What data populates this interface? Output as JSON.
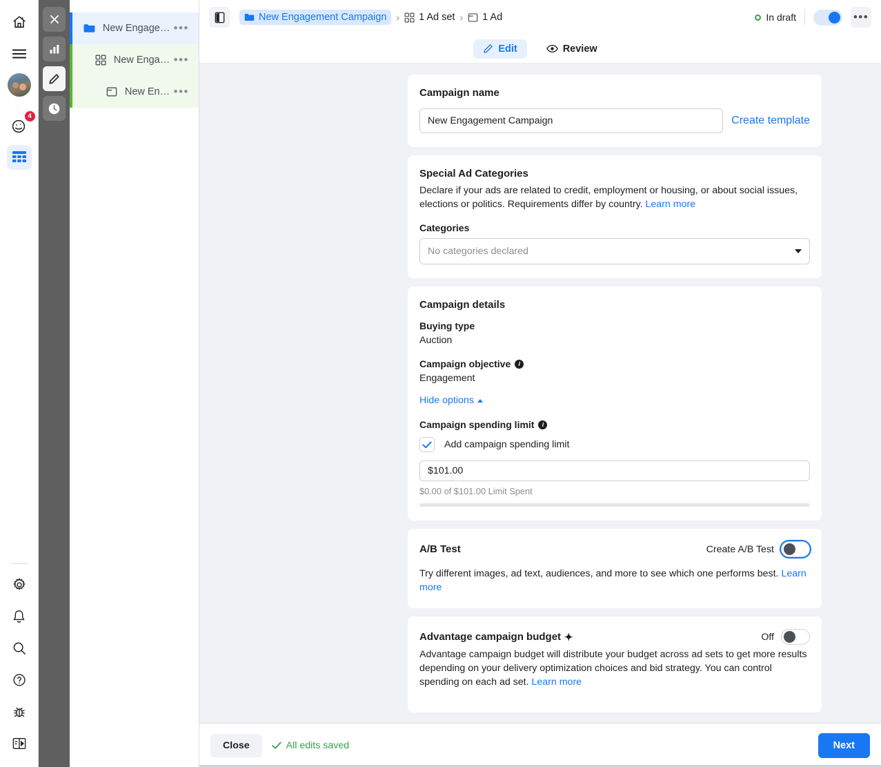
{
  "rail": {
    "items": [
      {
        "name": "home-icon",
        "label": "Home"
      },
      {
        "name": "menu-icon",
        "label": "Menu"
      },
      {
        "name": "avatar",
        "label": "Profile"
      },
      {
        "name": "sparkle-icon",
        "label": "Notifications",
        "badge": "4"
      },
      {
        "name": "grid-icon",
        "label": "Ads Manager",
        "active": true
      }
    ],
    "bottom_items": [
      {
        "name": "gear-icon",
        "label": "Settings"
      },
      {
        "name": "bell-icon",
        "label": "Alerts"
      },
      {
        "name": "search-icon",
        "label": "Search"
      },
      {
        "name": "help-icon",
        "label": "Help"
      },
      {
        "name": "bug-icon",
        "label": "Report bug"
      },
      {
        "name": "panel-icon",
        "label": "Toggle panel"
      }
    ]
  },
  "darkbar": {
    "items": [
      {
        "name": "close-icon",
        "label": "Close"
      },
      {
        "name": "chart-icon",
        "label": "Charts"
      },
      {
        "name": "pencil-icon",
        "label": "Edit",
        "active": true
      },
      {
        "name": "clock-icon",
        "label": "History"
      }
    ]
  },
  "tree": {
    "items": [
      {
        "label": "New Engage…",
        "icon": "folder-icon",
        "type": "campaign",
        "menu": "•••"
      },
      {
        "label": "New Enga…",
        "icon": "adset-grid-icon",
        "type": "adset",
        "menu": "•••"
      },
      {
        "label": "New En…",
        "icon": "ad-window-icon",
        "type": "ad",
        "menu": "•••"
      }
    ]
  },
  "topbar": {
    "breadcrumb": [
      {
        "label": "New Engagement Campaign",
        "icon": "folder-icon",
        "active": true
      },
      {
        "label": "1 Ad set",
        "icon": "adset-grid-icon",
        "active": false
      },
      {
        "label": "1 Ad",
        "icon": "ad-window-icon",
        "active": false
      }
    ],
    "separator": "›",
    "status_label": "In draft",
    "status_color": "#31a24c",
    "toggle_on": true,
    "more_label": "•••"
  },
  "tabs": [
    {
      "label": "Edit",
      "icon": "pencil-icon",
      "active": true
    },
    {
      "label": "Review",
      "icon": "eye-icon",
      "active": false
    }
  ],
  "campaign_name": {
    "title": "Campaign name",
    "value": "New Engagement Campaign",
    "placeholder": "Campaign name",
    "create_template_label": "Create template"
  },
  "special_ad_categories": {
    "title": "Special Ad Categories",
    "description": "Declare if your ads are related to credit, employment or housing, or about social issues, elections or politics. Requirements differ by country.",
    "learn_more": "Learn more",
    "categories_label": "Categories",
    "categories_value": "No categories declared"
  },
  "campaign_details": {
    "title": "Campaign details",
    "buying_type_label": "Buying type",
    "buying_type_value": "Auction",
    "objective_label": "Campaign objective",
    "objective_value": "Engagement",
    "hide_options_label": "Hide options",
    "spending_limit_label": "Campaign spending limit",
    "checkbox_label": "Add campaign spending limit",
    "checkbox_checked": true,
    "limit_value": "$101.00",
    "limit_note": "$0.00 of $101.00 Limit Spent",
    "progress_percent": 0
  },
  "ab_test": {
    "title": "A/B Test",
    "toggle_label": "Create A/B Test",
    "toggle_on": false,
    "description": "Try different images, ad text, audiences, and more to see which one performs best.",
    "learn_more": "Learn more"
  },
  "advantage_budget": {
    "title": "Advantage campaign budget",
    "sparkle": "✦",
    "toggle_label": "Off",
    "toggle_on": false,
    "description": "Advantage campaign budget will distribute your budget across ad sets to get more results depending on your delivery optimization choices and bid strategy. You can control spending on each ad set.",
    "learn_more": "Learn more"
  },
  "footer": {
    "close_label": "Close",
    "saved_label": "All edits saved",
    "saved_color": "#31a24c",
    "next_label": "Next"
  },
  "colors": {
    "accent_blue": "#1877f2",
    "green": "#31a24c",
    "badge_red": "#e41e3f",
    "page_bg": "#f0f2f5"
  }
}
